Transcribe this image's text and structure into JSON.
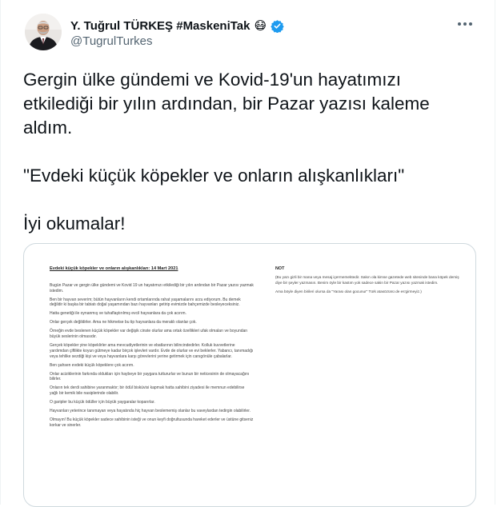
{
  "author": {
    "name": "Y. Tuğrul TÜRKEŞ #MaskeniTak",
    "handle": "@TugrulTurkes",
    "emoji": "😷",
    "verified_color": "#1d9bf0"
  },
  "tweet": {
    "paragraphs": [
      "Gergin ülke gündemi ve Kovid-19'un hayatımızı etkilediği bir yılın ardından, bir Pazar yazısı kaleme aldım.",
      "\"Evdeki küçük köpekler ve onların alışkanlıkları\"",
      "İyi okumalar!"
    ]
  },
  "document": {
    "title": "Evdeki küçük köpekler ve onların alışkanlıkları:     14 Mart 2021",
    "body": [
      "Bugün Pazar ve gergin ülke gündemi ve Kovid 19 un hayatımızı etkilediği bir yılın ardından bir Pazar yazısı yazmak istedim.",
      "Ben bir hayvan severim; bütün hayvanların kendi ortamlarında rahat yaşamalarını arzu ediyorum. Bu demek değildir ki başka bir tabiatı doğal yaşamından bazı hayvanları getirip evimizde bahçemizde besleyeceksiniz.",
      "Hatta genetiği ile oynanmış ve tuhaflaştırılmış evcil hayvanlara da çok acırım.",
      "Onlar gerçek değildirler. Ama ne hikmetse bu tip hayvanlara da meraklı olanlar çok.",
      "Örneğin evde beslenen küçük köpekler var değişik cinste olurlar ama ortak özellikleri ufak olmaları ve boyundan büyük seslerinin olmasıdır.",
      "Gerçek köpekler yine köpeklirler ama mevcudiyetlerinin ve ebatlarının bilincindedirler. Kolluk kuvvetlerine yardımdan çiftlikte koyun gütmeye kadar birçok işlevleri vardır. Evde de olurlar ve evi beklerler. Yabancı, tanımadığı veya tehlike sezdiği kişi ve veya hayvanlara karşı görevlerini yerine getirmek için canıgönüle çabalarlar.",
      "Ben şahsen evdeki küçük köpeklere çok acırım.",
      "Onlar aciziklerinin farkında oldukları için haybeye bir yaygara tuttururlar ve bunun bir neticesinin de olmayacağını bilirler.",
      "Onların tek derdi sahibine yaranmaktır; bir ödül bisküvisi kapmak hatta sahibini ziyadesi ile memnun edebilirse yağlı bir kemik bile nasiplerinde olabilir.",
      "O garipler bu küçük ödüller için büyük yaygaralar koparırlar.",
      "Hayvanları yeterince tanımayan veya hayatında hiç hayvan beslememiş olanlar bu vaveylardan tedirgin olabilirler.",
      "Olmayın! Bu küçük köpekler sadece sahibinin isteği ve onun keyfi doğrultusunda hareket ederler ve üstüne gitseniz korkar ve sinerler."
    ],
    "note_heading": "NOT",
    "note_body": [
      "(Bu yazı gizli bir mana veya mesaj içermemektedir. Sakın ola kimse gazetede web sitesinde bana köpek demiş diye bir şeyler yazmasın. Benim öyle bir kastım yok sadece sakin bir Pazar yazısı yazmak istedim.",
      "Ama böyle diyen birileri olursa da \"Yarası olan gocunur\" Türk atasözünü de es'girmeyiz.)"
    ]
  }
}
